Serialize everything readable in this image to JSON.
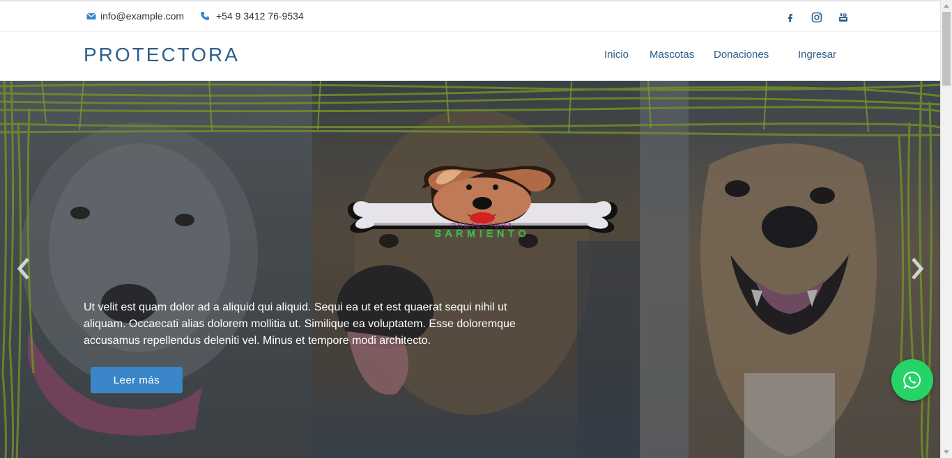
{
  "topbar": {
    "email": "info@example.com",
    "phone": "+54 9 3412 76-9534",
    "social": [
      "facebook-icon",
      "instagram-icon",
      "youtube-icon"
    ]
  },
  "header": {
    "logo": "PROTECTORA",
    "nav": [
      "Inicio",
      "Mascotas",
      "Donaciones",
      "Ingresar"
    ]
  },
  "hero": {
    "brand_logo_text_top": "PROTECTORA",
    "brand_logo_text_bottom": "SARMIENTO",
    "caption": "Ut velit est quam dolor ad a aliquid qui aliquid. Sequi ea ut et est quaerat sequi nihil ut aliquam. Occaecati alias dolorem mollitia ut. Similique ea voluptatem. Esse doloremque accusamus repellendus deleniti vel. Minus et tempore modi architecto.",
    "button": "Leer más"
  },
  "colors": {
    "brand": "#2c5f8a",
    "button": "#3b86c9",
    "whatsapp": "#25d366",
    "grass": "#6f8f2a"
  }
}
